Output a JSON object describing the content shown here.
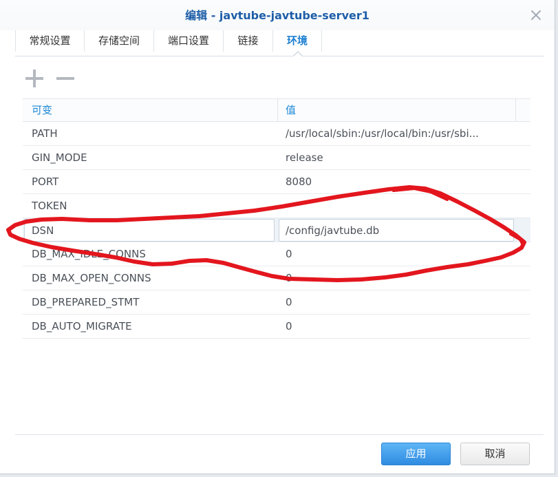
{
  "window": {
    "title": "编辑 - javtube-javtube-server1",
    "close_icon": "close-icon"
  },
  "tabs": [
    {
      "label": "常规设置",
      "active": false
    },
    {
      "label": "存储空间",
      "active": false
    },
    {
      "label": "端口设置",
      "active": false
    },
    {
      "label": "链接",
      "active": false
    },
    {
      "label": "环境",
      "active": true
    }
  ],
  "toolbar": {
    "add_icon": "plus-icon",
    "remove_icon": "minus-icon"
  },
  "table": {
    "columns": {
      "variable": "可变",
      "value": "值"
    },
    "rows": [
      {
        "name": "PATH",
        "value": "/usr/local/sbin:/usr/local/bin:/usr/sbi..."
      },
      {
        "name": "GIN_MODE",
        "value": "release"
      },
      {
        "name": "PORT",
        "value": "8080"
      },
      {
        "name": "TOKEN",
        "value": ""
      },
      {
        "name": "DSN",
        "value": "/config/javtube.db",
        "editing": true
      },
      {
        "name": "DB_MAX_IDLE_CONNS",
        "value": "0"
      },
      {
        "name": "DB_MAX_OPEN_CONNS",
        "value": "0"
      },
      {
        "name": "DB_PREPARED_STMT",
        "value": "0"
      },
      {
        "name": "DB_AUTO_MIGRATE",
        "value": "0"
      }
    ]
  },
  "footer": {
    "apply_label": "应用",
    "cancel_label": "取消"
  },
  "colors": {
    "title": "#1e5ea8",
    "active_tab": "#1b7fd2",
    "column_header": "#1a88d8",
    "primary_button": "#2f8ce1",
    "annotation_red": "#e3161e"
  }
}
